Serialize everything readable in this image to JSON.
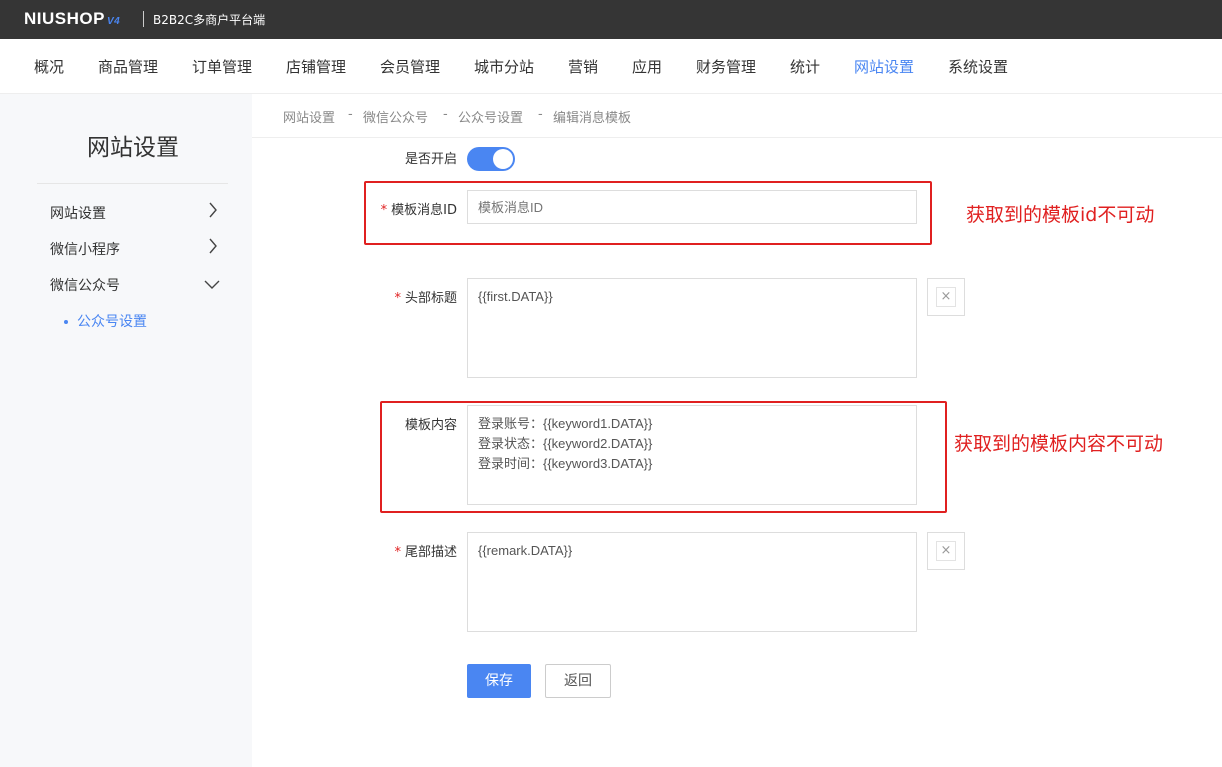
{
  "header": {
    "logo": "NIUSHOP",
    "logo_version": "V4",
    "subtitle": "B2B2C多商户平台端"
  },
  "nav": {
    "items": [
      "概况",
      "商品管理",
      "订单管理",
      "店铺管理",
      "会员管理",
      "城市分站",
      "营销",
      "应用",
      "财务管理",
      "统计",
      "网站设置",
      "系统设置"
    ],
    "active": "网站设置"
  },
  "sidebar": {
    "title": "网站设置",
    "items": [
      {
        "label": "网站设置",
        "icon": "chevron-right-icon"
      },
      {
        "label": "微信小程序",
        "icon": "chevron-right-icon"
      },
      {
        "label": "微信公众号",
        "icon": "chevron-down-icon"
      }
    ],
    "sub_item": "公众号设置"
  },
  "breadcrumb": [
    "网站设置",
    "-",
    "微信公众号",
    "-",
    "公众号设置",
    "-",
    "编辑消息模板"
  ],
  "form": {
    "enable_label": "是否开启",
    "enabled": true,
    "required_mark": "*",
    "template_id_label": "模板消息ID",
    "template_id_placeholder": "模板消息ID",
    "header_title_label": "头部标题",
    "header_title_value": "{{first.DATA}}",
    "content_label": "模板内容",
    "content_lines": [
      "登录账号：{{keyword1.DATA}}",
      "登录状态：{{keyword2.DATA}}",
      "登录时间：{{keyword3.DATA}}"
    ],
    "footer_label": "尾部描述",
    "footer_value": "{{remark.DATA}}",
    "clear_symbol": "×",
    "save_label": "保存",
    "back_label": "返回"
  },
  "annotations": {
    "id_note": "获取到的模板id不可动",
    "content_note": "获取到的模板内容不可动"
  },
  "colors": {
    "accent": "#4a86f2",
    "annotation_red": "#e02020",
    "topbar": "#353535"
  }
}
